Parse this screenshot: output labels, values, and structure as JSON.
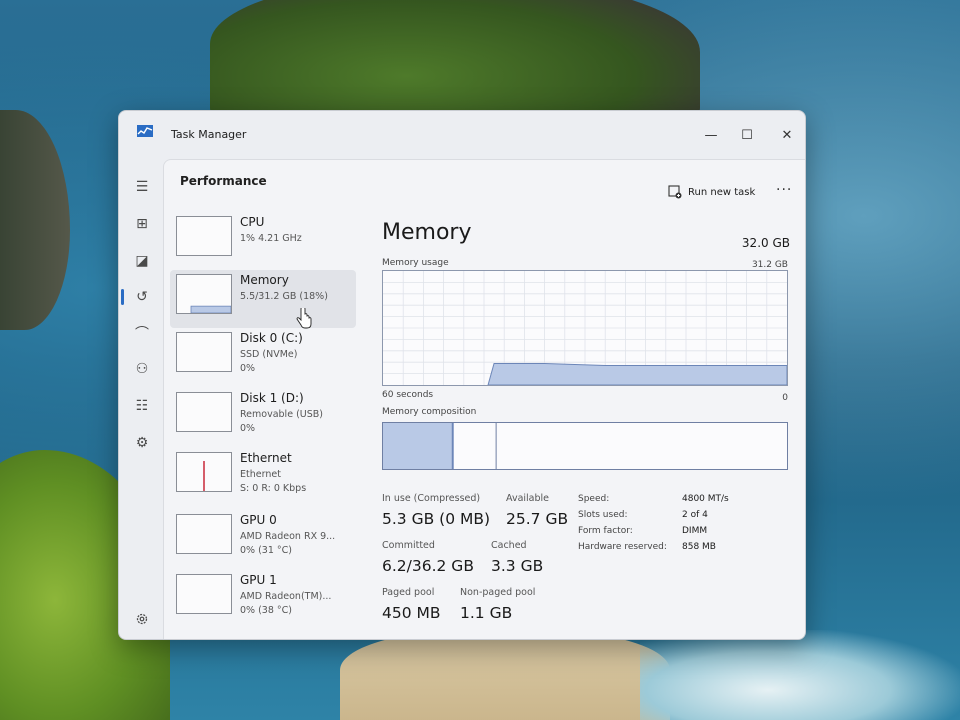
{
  "window": {
    "title": "Task Manager",
    "controls": {
      "minimize": "—",
      "maximize": "☐",
      "close": "✕"
    }
  },
  "nav": {
    "items": [
      {
        "icon": "hamburger-menu-icon",
        "glyph": "☰"
      },
      {
        "icon": "processes-icon",
        "glyph": "⊞"
      },
      {
        "icon": "performance-icon",
        "glyph": "◪"
      },
      {
        "icon": "app-history-icon",
        "glyph": "↺"
      },
      {
        "icon": "startup-apps-icon",
        "glyph": "⌒"
      },
      {
        "icon": "users-icon",
        "glyph": "⚇"
      },
      {
        "icon": "details-icon",
        "glyph": "☷"
      },
      {
        "icon": "services-icon",
        "glyph": "⚙"
      }
    ],
    "settings_icon": "settings-icon",
    "active_index": 2
  },
  "page": {
    "title": "Performance",
    "run_new_task": "Run new task",
    "more": "···"
  },
  "devices": [
    {
      "name": "CPU",
      "sub": "1% 4.21 GHz",
      "sub2": ""
    },
    {
      "name": "Memory",
      "sub": "5.5/31.2 GB (18%)",
      "sub2": "",
      "selected": true
    },
    {
      "name": "Disk 0 (C:)",
      "sub": "SSD (NVMe)",
      "sub2": "0%"
    },
    {
      "name": "Disk 1 (D:)",
      "sub": "Removable (USB)",
      "sub2": "0%"
    },
    {
      "name": "Ethernet",
      "sub": "Ethernet",
      "sub2": "S: 0 R: 0 Kbps"
    },
    {
      "name": "GPU 0",
      "sub": "AMD Radeon RX 9...",
      "sub2": "0% (31 °C)"
    },
    {
      "name": "GPU 1",
      "sub": "AMD Radeon(TM)...",
      "sub2": "0% (38 °C)"
    }
  ],
  "detail": {
    "title": "Memory",
    "total": "32.0 GB",
    "usage_label": "Memory usage",
    "usage_max": "31.2 GB",
    "time_span": "60 seconds",
    "time_end": "0",
    "composition_label": "Memory composition",
    "usage_fraction": 0.18,
    "composition": {
      "in_use": 0.17,
      "modified": 0.005,
      "standby": 0.105,
      "free": 0.72
    },
    "stats": {
      "in_use_label": "In use (Compressed)",
      "in_use_value": "5.3 GB (0 MB)",
      "available_label": "Available",
      "available_value": "25.7 GB",
      "committed_label": "Committed",
      "committed_value": "6.2/36.2 GB",
      "cached_label": "Cached",
      "cached_value": "3.3 GB",
      "paged_label": "Paged pool",
      "paged_value": "450 MB",
      "nonpaged_label": "Non-paged pool",
      "nonpaged_value": "1.1 GB"
    },
    "specs": {
      "speed_label": "Speed:",
      "speed_value": "4800 MT/s",
      "slots_label": "Slots used:",
      "slots_value": "2 of 4",
      "form_label": "Form factor:",
      "form_value": "DIMM",
      "reserved_label": "Hardware reserved:",
      "reserved_value": "858 MB"
    }
  },
  "colors": {
    "graph_fill": "#b9c9e6",
    "graph_line": "#6c86b8",
    "ethernet_spike": "#c8283a",
    "accent": "#2a6cc4"
  }
}
